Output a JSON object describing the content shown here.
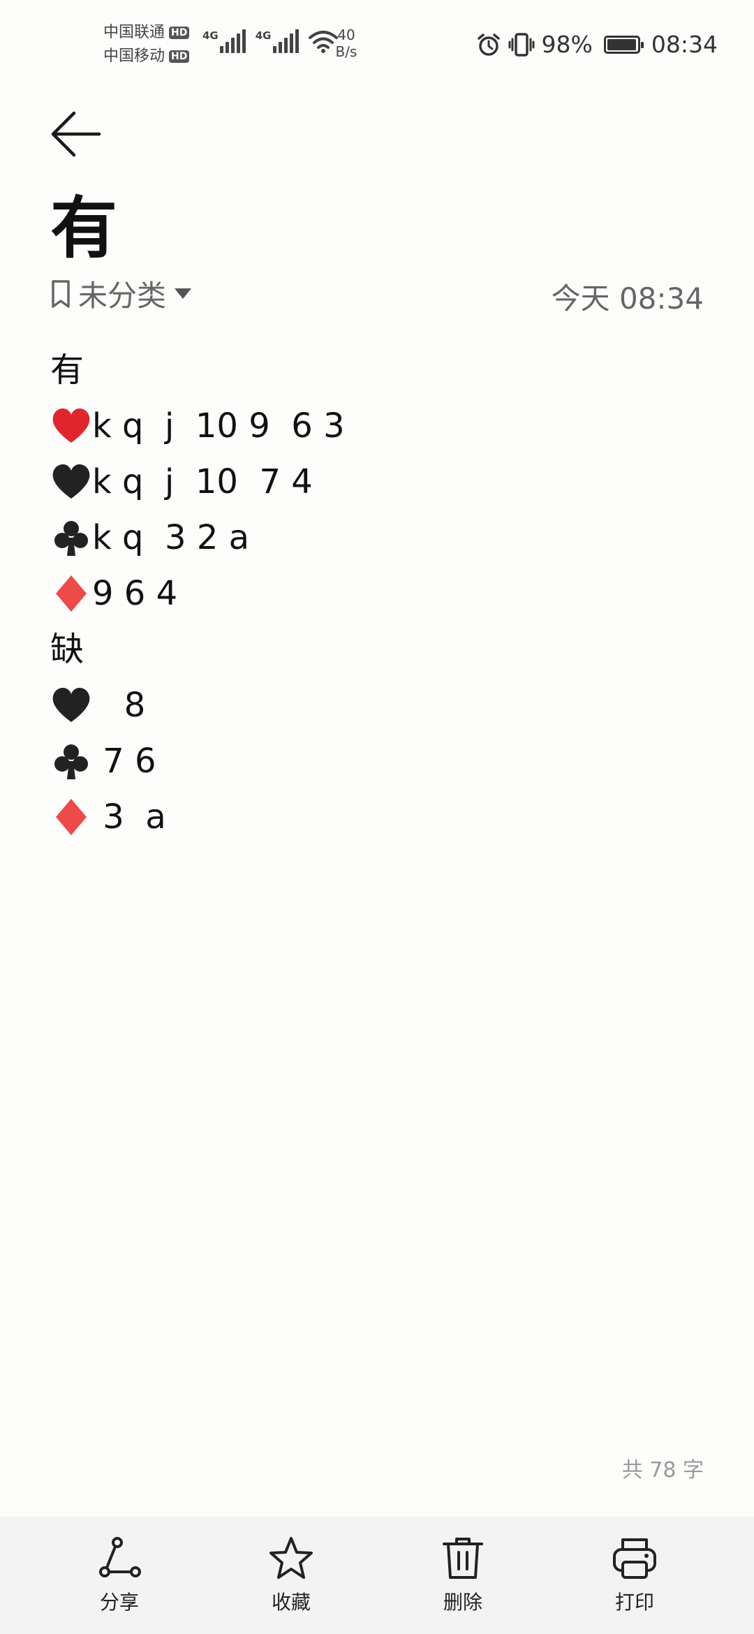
{
  "status_bar": {
    "carrier_1": "中国联通",
    "carrier_2": "中国移动",
    "hd_label": "HD",
    "network_type": "4G",
    "speed_value": "40",
    "speed_unit": "B/s",
    "battery_percent": "98%",
    "battery_level": 0.98,
    "time": "08:34",
    "icons": [
      "alarm-icon",
      "vibrate-icon",
      "wifi-icon",
      "signal-icon",
      "battery-icon"
    ]
  },
  "header": {
    "back_icon": "arrow-left-icon",
    "title": "有",
    "category": "未分类",
    "timestamp": "今天 08:34"
  },
  "note": {
    "lines": [
      {
        "suit": "",
        "text": "有"
      },
      {
        "suit": "heart-red",
        "text": "k q  j  10 9  6 3"
      },
      {
        "suit": "heart-black",
        "text": "k q  j  10  7 4"
      },
      {
        "suit": "club",
        "text": "k q  3 2 a"
      },
      {
        "suit": "diamond",
        "text": "9 6 4"
      },
      {
        "suit": "",
        "text": "缺"
      },
      {
        "suit": "heart-black",
        "text": "   8"
      },
      {
        "suit": "club",
        "text": " 7 6"
      },
      {
        "suit": "diamond",
        "text": " 3  a"
      }
    ]
  },
  "word_count": "共 78 字",
  "toolbar": {
    "share": "分享",
    "favorite": "收藏",
    "delete": "删除",
    "print": "打印"
  },
  "colors": {
    "background": "#fdfdfb",
    "toolbar_bg": "#f3f3f3",
    "heart_red": "#e0262d",
    "diamond_red": "#ee4a4a",
    "black_suit": "#222222",
    "muted_text": "#666666"
  }
}
